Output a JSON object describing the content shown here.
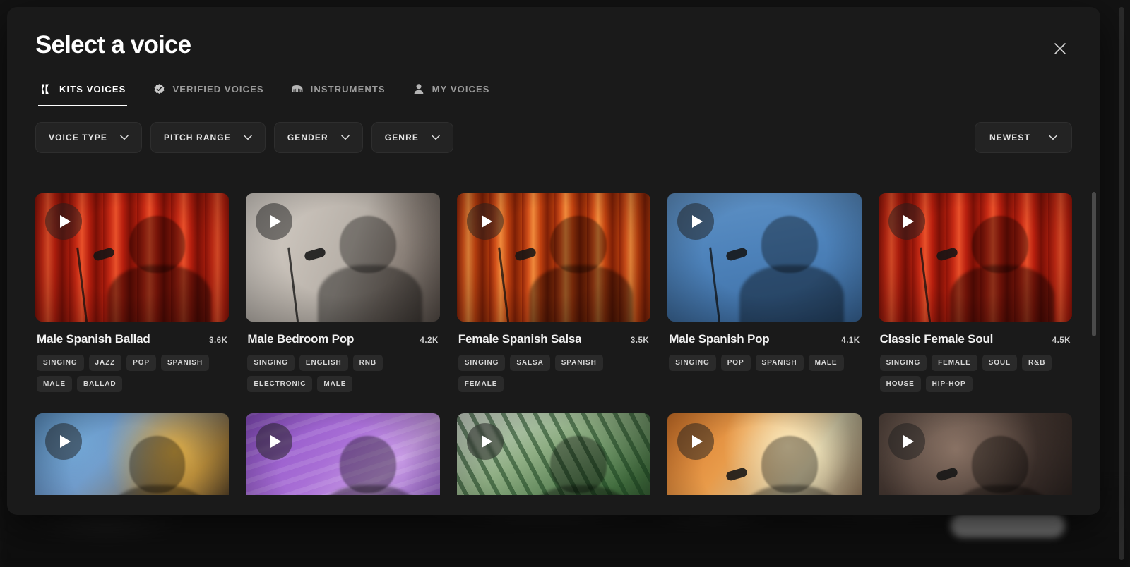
{
  "modal": {
    "title": "Select a voice",
    "close_label": "Close"
  },
  "tabs": [
    {
      "label": "KITS VOICES",
      "icon": "kits-logo-icon",
      "active": true
    },
    {
      "label": "VERIFIED VOICES",
      "icon": "verified-badge-icon",
      "active": false
    },
    {
      "label": "INSTRUMENTS",
      "icon": "piano-icon",
      "active": false
    },
    {
      "label": "MY VOICES",
      "icon": "person-icon",
      "active": false
    }
  ],
  "filters": [
    {
      "label": "VOICE TYPE"
    },
    {
      "label": "PITCH RANGE"
    },
    {
      "label": "GENDER"
    },
    {
      "label": "GENRE"
    }
  ],
  "sort": {
    "label": "NEWEST"
  },
  "voices": [
    {
      "title": "Male Spanish Ballad",
      "plays": "3.6K",
      "tags": [
        "SINGING",
        "JAZZ",
        "POP",
        "SPANISH",
        "MALE",
        "BALLAD"
      ],
      "art": "art-red-curtain",
      "scene": "man-in-suit-singing-red-curtain"
    },
    {
      "title": "Male Bedroom Pop",
      "plays": "4.2K",
      "tags": [
        "SINGING",
        "ENGLISH",
        "RNB",
        "ELECTRONIC",
        "MALE"
      ],
      "art": "art-studio-light",
      "scene": "man-with-headphones-at-microphone"
    },
    {
      "title": "Female Spanish Salsa",
      "plays": "3.5K",
      "tags": [
        "SINGING",
        "SALSA",
        "SPANISH",
        "FEMALE"
      ],
      "art": "art-orange-curtain",
      "scene": "woman-singing-orange-curtain"
    },
    {
      "title": "Male Spanish Pop",
      "plays": "4.1K",
      "tags": [
        "SINGING",
        "POP",
        "SPANISH",
        "MALE"
      ],
      "art": "art-blue-sky",
      "scene": "singer-in-straw-hat-blue-sky"
    },
    {
      "title": "Classic Female Soul",
      "plays": "4.5K",
      "tags": [
        "SINGING",
        "FEMALE",
        "SOUL",
        "R&B",
        "HOUSE",
        "HIP-HOP"
      ],
      "art": "art-red-curtain",
      "scene": "woman-singing-red-curtain"
    },
    {
      "title": "",
      "plays": "",
      "tags": [],
      "art": "art-carnival",
      "scene": "dreadlocked-singer-carnival"
    },
    {
      "title": "",
      "plays": "",
      "tags": [],
      "art": "art-purple",
      "scene": "blue-haired-singer-purple-backdrop"
    },
    {
      "title": "",
      "plays": "",
      "tags": [],
      "art": "art-palms",
      "scene": "woman-among-palm-leaves"
    },
    {
      "title": "",
      "plays": "",
      "tags": [],
      "art": "art-warm-stage",
      "scene": "curly-haired-singer-warm-light"
    },
    {
      "title": "",
      "plays": "",
      "tags": [],
      "art": "art-dim-studio",
      "scene": "man-singing-dim-studio"
    }
  ],
  "colors": {
    "modal_background": "#1a1a1a",
    "page_background": "#0a0a0a",
    "accent_text": "#ffffff",
    "muted_text": "#9b9b9b",
    "chip_background": "#232323",
    "tag_background": "#2a2a2a"
  }
}
